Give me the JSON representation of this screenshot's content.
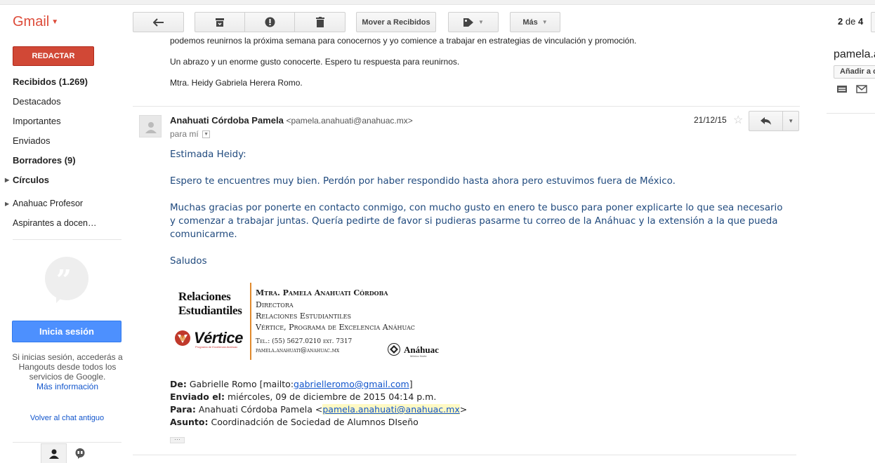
{
  "app": {
    "name": "Gmail"
  },
  "toolbar": {
    "move_to_inbox": "Mover a Recibidos",
    "more": "Más",
    "pager_current": "2",
    "pager_of": "de",
    "pager_total": "4"
  },
  "sidebar": {
    "compose": "REDACTAR",
    "items": [
      {
        "label": "Recibidos (1.269)",
        "bold": true
      },
      {
        "label": "Destacados",
        "bold": false
      },
      {
        "label": "Importantes",
        "bold": false
      },
      {
        "label": "Enviados",
        "bold": false
      },
      {
        "label": "Borradores (9)",
        "bold": true
      },
      {
        "label": "Círculos",
        "bold": true
      },
      {
        "label": "Anahuac Profesor",
        "bold": false
      },
      {
        "label": "Aspirantes a docen…",
        "bold": false
      }
    ],
    "hangouts": {
      "signin": "Inicia sesión",
      "text": "Si inicias sesión, accederás a Hangouts desde todos los servicios de Google.",
      "more_info": "Más información",
      "old_chat": "Volver al chat antiguo"
    }
  },
  "previous_message": {
    "line1": "podemos reunirnos la próxima semana para conocernos y yo comience a trabajar en estrategias de vinculación y promoción.",
    "line2": "Un abrazo y un enorme gusto conocerte. Espero tu respuesta para reunirnos.",
    "line3": "Mtra. Heidy Gabriela Herera Romo."
  },
  "message": {
    "sender_name": "Anahuati Córdoba Pamela",
    "sender_email": "<pamela.anahuati@anahuac.mx>",
    "to": "para mí",
    "date": "21/12/15",
    "body": [
      "Estimada Heidy:",
      "Espero te encuentres muy bien. Perdón por haber respondido hasta ahora pero estuvimos fuera de México.",
      "Muchas gracias por ponerte en contacto conmigo, con mucho gusto en enero te busco para poner explicarte lo que sea necesario",
      "y comenzar a trabajar juntas. Quería pedirte de favor si pudieras pasarme tu correo de la Anáhuac y la extensión a la que pueda",
      "comunicarme.",
      "Saludos"
    ],
    "signature": {
      "dept_line1": "Relaciones",
      "dept_line2": "Estudiantiles",
      "brand": "Vértice",
      "brand_sub": "Programa de Excelencia Anáhuac",
      "name": "Mtra. Pamela Anahuati Córdoba",
      "title": "Directora",
      "office": "Relaciones Estudiantiles",
      "program": "Vértice, Programa de Excelencia Anáhuac",
      "phone": "Tel.: (55) 5627.0210 ext. 7317",
      "email": "pamela.anahuati@anahuac.mx",
      "univ": "Anáhuac",
      "univ_sub": "México Norte"
    },
    "quoted": {
      "from_label": "De:",
      "from_name": "Gabrielle Romo [mailto:",
      "from_link": "gabrielleromo@gmail.com",
      "from_end": "]",
      "sent_label": "Enviado el:",
      "sent_value": "miércoles, 09 de diciembre de 2015 04:14 p.m.",
      "to_label": "Para:",
      "to_name": "Anahuati Córdoba Pamela <",
      "to_link": "pamela.anahuati@anahuac.mx",
      "to_end": ">",
      "subject_label": "Asunto:",
      "subject_value": "Coordinadción de Sociedad de Alumnos DIseño"
    }
  },
  "right_panel": {
    "name": "pamela.a",
    "add_button": "Añadir a c"
  },
  "colors": {
    "brand_red": "#dd4b39",
    "compose_red": "#d14836",
    "signin_blue": "#4d90fe",
    "body_text": "#1f497d",
    "link": "#1155cc"
  }
}
